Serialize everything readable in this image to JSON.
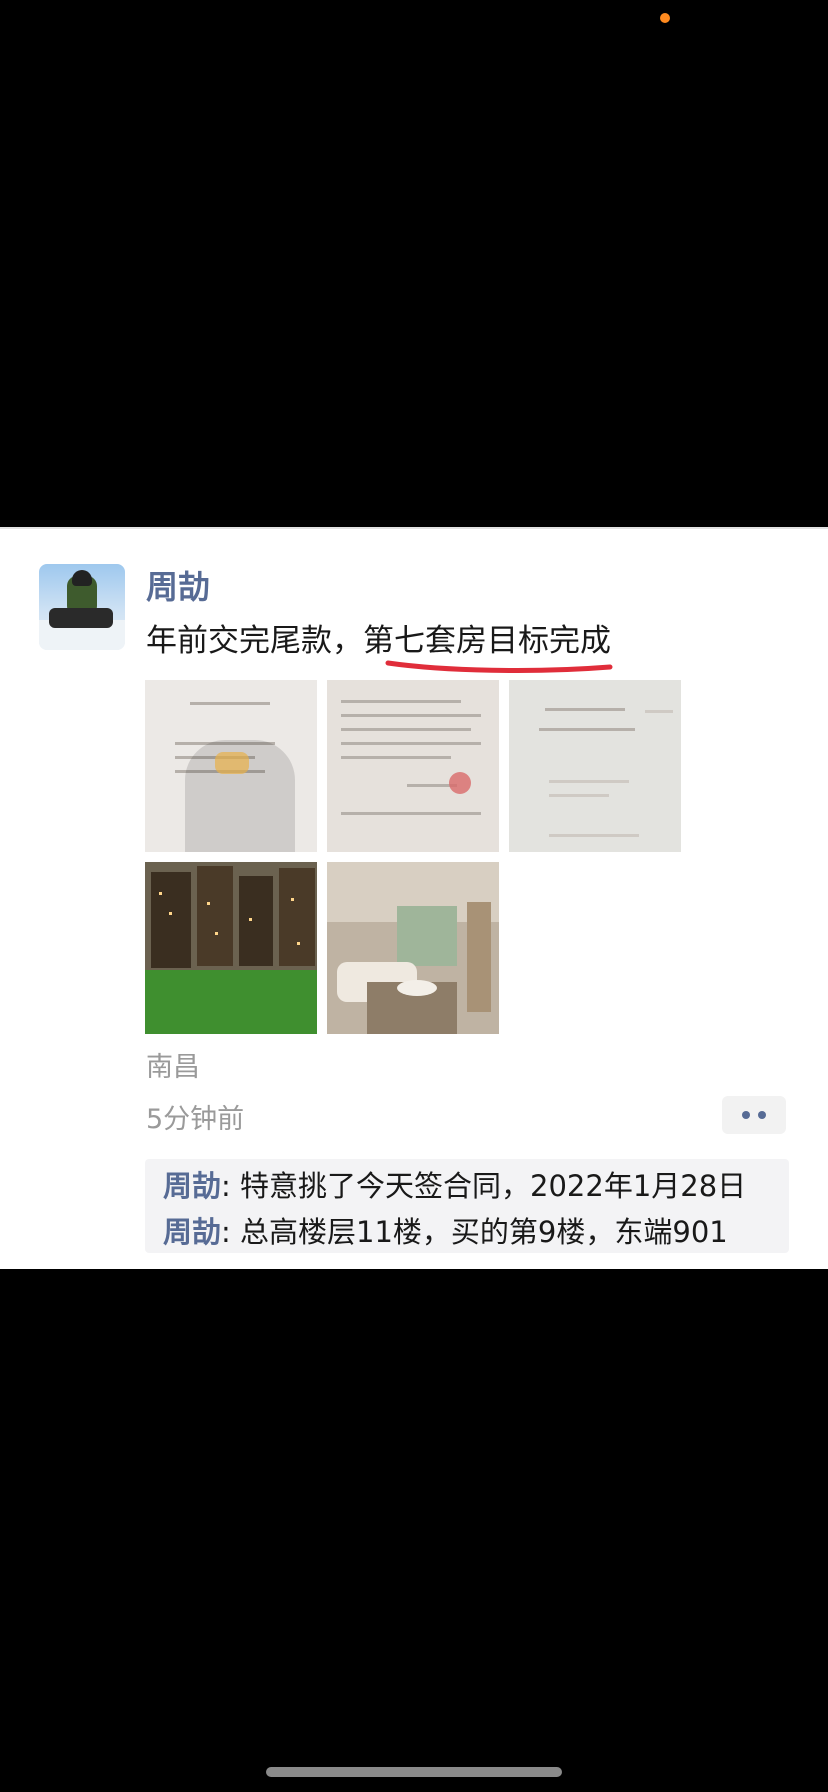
{
  "post": {
    "author": "周劼",
    "text": "年前交完尾款，第七套房目标完成",
    "location": "南昌",
    "time": "5分钟前",
    "images": [
      "contract-page-photo",
      "signed-contract-photo",
      "contract-cover-photo",
      "building-model-photo",
      "living-room-photo"
    ]
  },
  "comments": [
    {
      "name": "周劼",
      "sep": ": ",
      "text": "特意挑了今天签合同，2022年1月28日"
    },
    {
      "name": "周劼",
      "sep": ": ",
      "text": "总高楼层11楼，买的第9楼，东端901"
    }
  ],
  "colors": {
    "name_link": "#576b95",
    "meta_gray": "#9a9a9a",
    "underline_red": "#e02d3a",
    "status_dot": "#ff8a1f"
  },
  "icons": [
    "more-dots-icon"
  ]
}
